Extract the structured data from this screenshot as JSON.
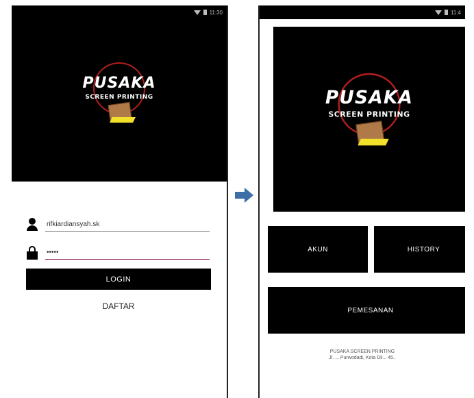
{
  "status_bar": {
    "left_time": "11:30",
    "right_time": "11:4"
  },
  "login_screen": {
    "banner": {
      "brand": "PUSAKA",
      "tagline": "SCREEN PRINTING"
    },
    "username": {
      "value": "rifkiardiansyah.sk"
    },
    "password": {
      "value": "•••••"
    },
    "login_label": "LOGIN",
    "register_label": "DAFTAR"
  },
  "menu_screen": {
    "banner": {
      "brand": "PUSAKA",
      "tagline": "SCREEN PRINTING"
    },
    "akun_label": "AKUN",
    "history_label": "HISTORY",
    "pemesanan_label": "PEMESANAN",
    "footer": {
      "line1": "PUSAKA SCREEN PRINTING",
      "line2": "Jl. ... Purwodadi, Kota Dil... 45.."
    }
  },
  "colors": {
    "banner_bg": "#000000",
    "logo_ring": "#b31e1e",
    "squeegee_ink": "#f2e02a",
    "arrow": "#3d6fa6"
  },
  "icons": {
    "user": "user-icon",
    "lock": "lock-icon",
    "arrow": "arrow-right-icon"
  }
}
